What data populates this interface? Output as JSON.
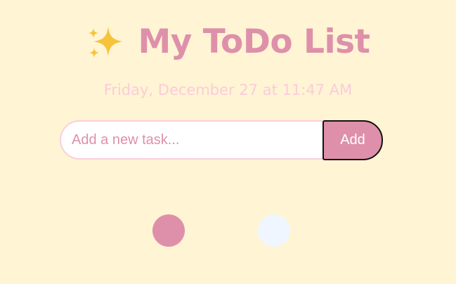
{
  "header": {
    "icon": "sparkles-icon",
    "title": "My ToDo List"
  },
  "date_text": "Friday, December 27 at 11:47 AM",
  "task_input": {
    "placeholder": "Add a new task...",
    "value": ""
  },
  "add_button": {
    "label": "Add"
  },
  "theme_dots": [
    {
      "name": "pink",
      "color": "#DE90AA"
    },
    {
      "name": "light-blue",
      "color": "#F0F6FF"
    }
  ],
  "colors": {
    "background": "#FFF4D4",
    "accent": "#DE90AA",
    "date_text": "#FBCCDA",
    "sparkle": "#F7C33A"
  }
}
